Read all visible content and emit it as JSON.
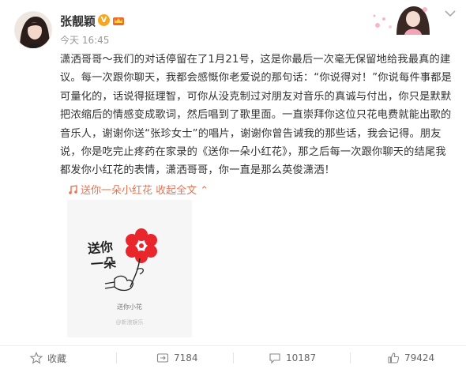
{
  "author": {
    "name": "张靓颖",
    "verified_mark": "V",
    "timestamp": "今天 16:45"
  },
  "post": {
    "paragraph": "潇洒哥哥～我们的对话停留在了1月21号，这是你最后一次毫无保留地给我最真的建议。每一次跟你聊天，我都会感慨你老爱说的那句话：“你说得对！”你说每件事都是可量化的，话说得挺理智，可你从没克制过对朋友对音乐的真诚与付出，你只是默默把浓缩后的情感变成歌词，然后唱到了歌里面。一直崇拜你这位只花电费就能出歌的音乐人，谢谢你送“张珍女士”的唱片，谢谢你曾告诫我的那些话，我会记得。朋友说，你是吃完止疼药在家录的《送你一朵小红花》，那之后每一次跟你聊天的结尾我都发你小红花的表情，潇洒哥哥，你一直是那么英俊潇洒！",
    "more_link": "送你一朵小红花 收起全文 ⌃"
  },
  "image": {
    "handwriting_line1": "送你",
    "handwriting_line2": "一朵",
    "caption": "送你小花",
    "watermark": "@新浪娱乐"
  },
  "actions": {
    "share_label": "收藏",
    "repost_count": "7184",
    "comment_count": "10187",
    "like_count": "79424"
  },
  "colors": {
    "link": "#eb7350",
    "flower": "#e8262c",
    "verified": "#f5a623"
  }
}
